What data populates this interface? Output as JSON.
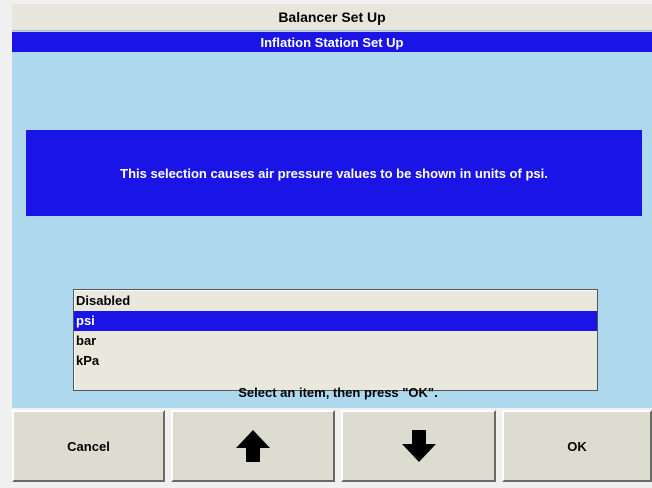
{
  "window": {
    "title": "Balancer Set Up"
  },
  "header": {
    "subtitle": "Inflation Station Set Up"
  },
  "message": {
    "text": "This selection causes air pressure values to be shown in units of psi."
  },
  "list": {
    "items": [
      {
        "label": "Disabled",
        "selected": false
      },
      {
        "label": "psi",
        "selected": true
      },
      {
        "label": "bar",
        "selected": false
      },
      {
        "label": "kPa",
        "selected": false
      }
    ]
  },
  "prompt": {
    "text": "Select an item, then press \"OK\"."
  },
  "buttons": {
    "cancel_label": "Cancel",
    "up_icon": "arrow-up-icon",
    "down_icon": "arrow-down-icon",
    "ok_label": "OK"
  },
  "colors": {
    "highlight": "#1a14e6",
    "background": "#aed8ee",
    "panel": "#e8e8dc"
  }
}
